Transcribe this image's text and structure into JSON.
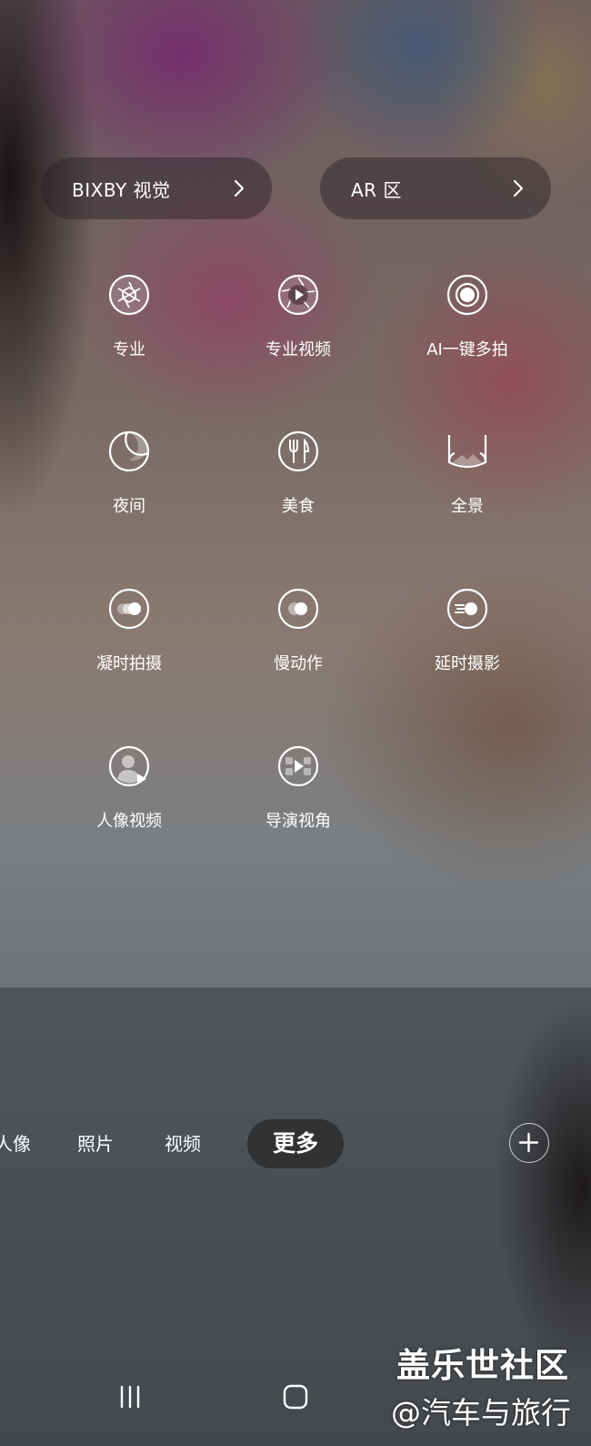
{
  "top_buttons": {
    "bixby_vision": "BIXBY 视觉",
    "ar_zone": "AR 区"
  },
  "modes": [
    {
      "label": "专业",
      "icon": "aperture-icon"
    },
    {
      "label": "专业视频",
      "icon": "aperture-play-icon"
    },
    {
      "label": "AI一键多拍",
      "icon": "single-take-icon"
    },
    {
      "label": "夜间",
      "icon": "moon-icon"
    },
    {
      "label": "美食",
      "icon": "fork-knife-icon"
    },
    {
      "label": "全景",
      "icon": "panorama-icon"
    },
    {
      "label": "凝时拍摄",
      "icon": "hyperlapse-icon"
    },
    {
      "label": "慢动作",
      "icon": "slow-motion-icon"
    },
    {
      "label": "延时摄影",
      "icon": "time-lapse-icon"
    },
    {
      "label": "人像视频",
      "icon": "portrait-video-icon"
    },
    {
      "label": "导演视角",
      "icon": "director-view-icon"
    }
  ],
  "tabs": [
    {
      "label": "人像"
    },
    {
      "label": "照片"
    },
    {
      "label": "视频"
    },
    {
      "label": "更多",
      "active": true
    }
  ],
  "watermark": {
    "line1": "盖乐世社区",
    "line2": "@汽车与旅行"
  }
}
